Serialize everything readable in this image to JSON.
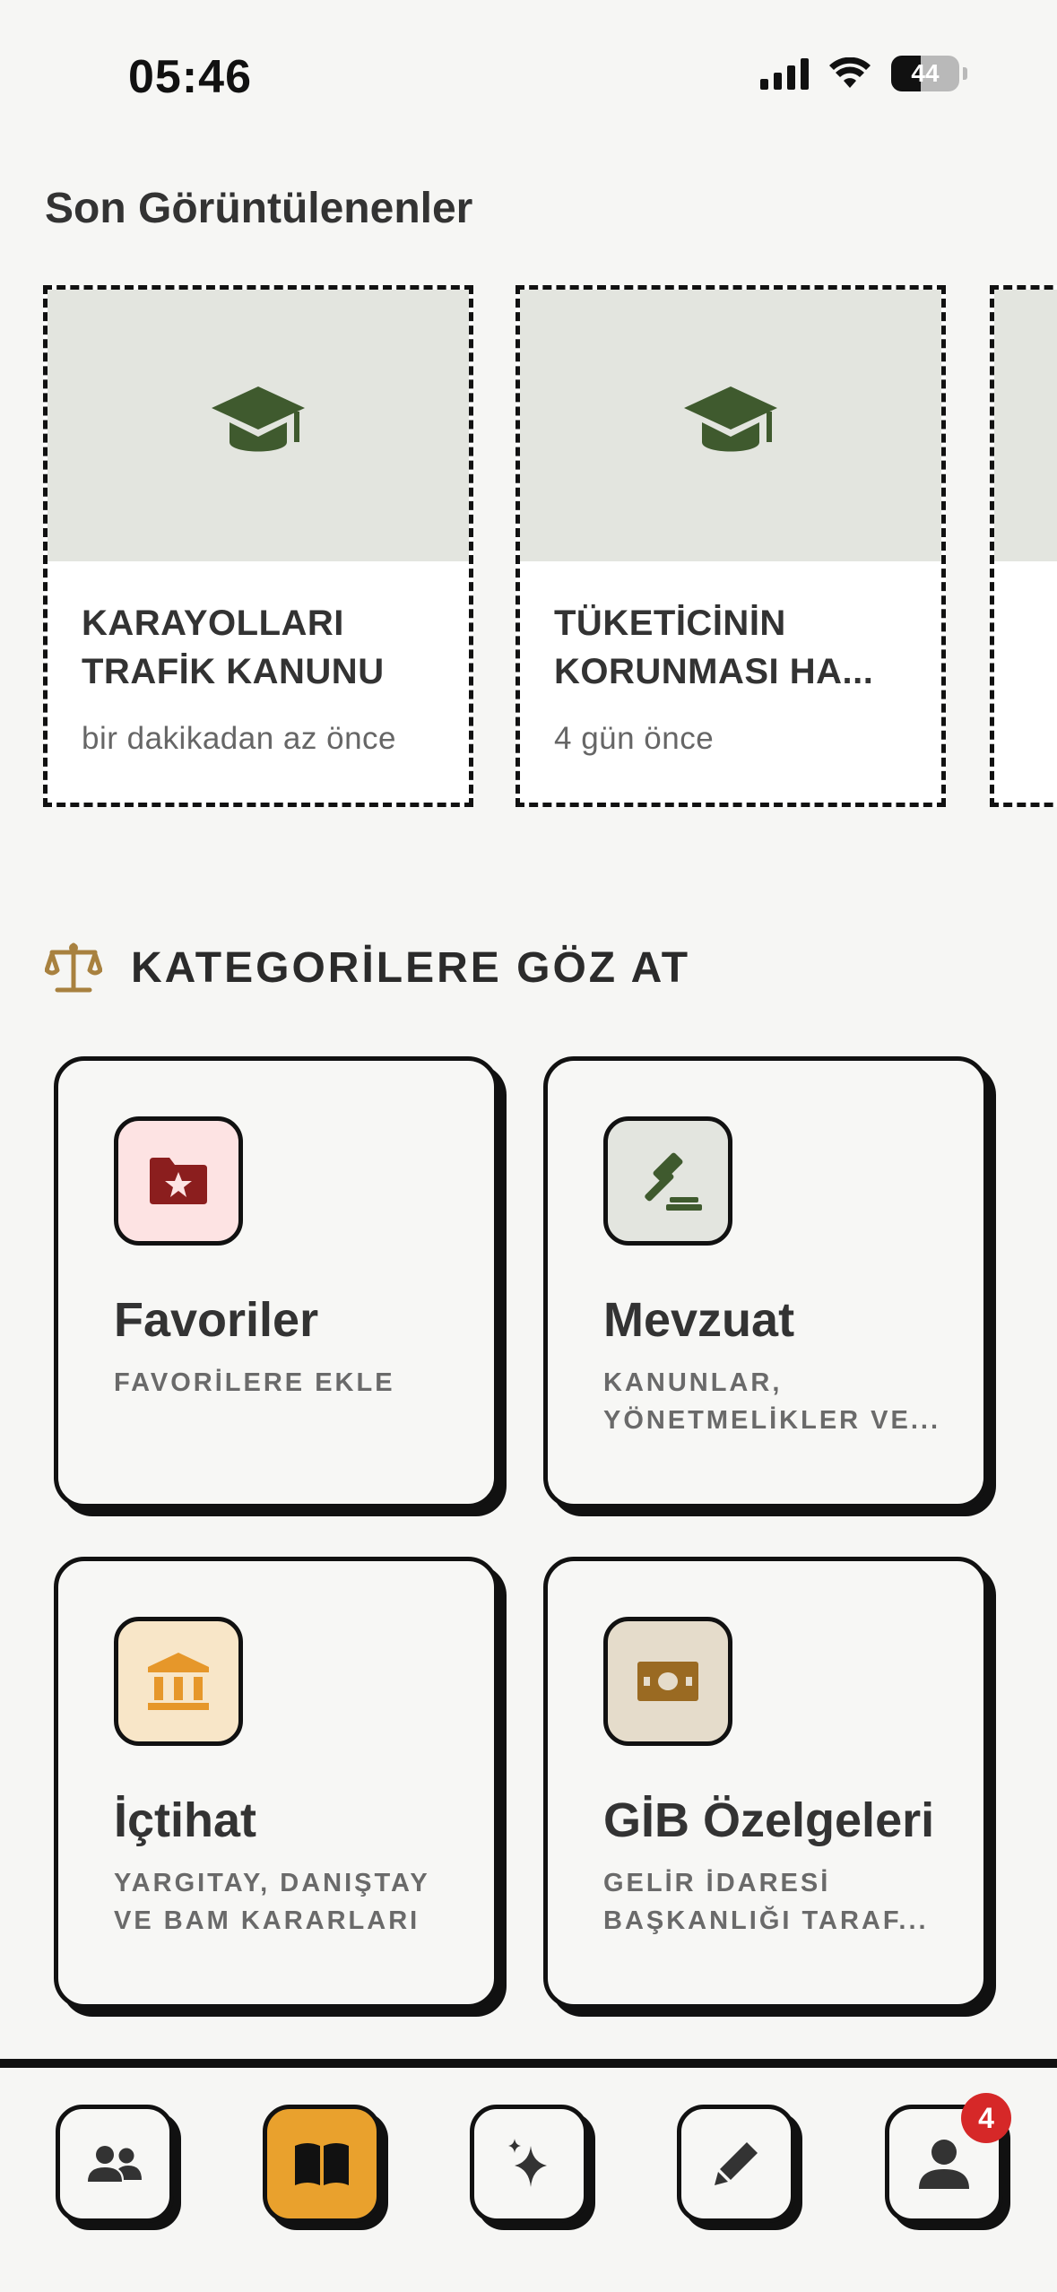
{
  "status_bar": {
    "time": "05:46",
    "battery": "44",
    "battery_level": 0.44
  },
  "recent": {
    "title": "Son Görüntülenenler",
    "items": [
      {
        "title": "KARAYOLLARI TRAFİK KANUNU",
        "time": "bir dakikadan az önce",
        "icon": "graduation-cap-icon"
      },
      {
        "title": "TÜKETİCİNİN KORUNMASI HA...",
        "time": "4 gün önce",
        "icon": "graduation-cap-icon"
      }
    ]
  },
  "categories": {
    "title": "KATEGORİLERE GÖZ AT",
    "icon": "scales-icon",
    "items": [
      {
        "name": "Favoriler",
        "desc": "FAVORİLERE EKLE",
        "icon": "folder-star-icon",
        "bg": "#fde3e3",
        "color": "#8b1e1e"
      },
      {
        "name": "Mevzuat",
        "desc": "KANUNLAR, YÖNETMELİKLER VE...",
        "icon": "gavel-icon",
        "bg": "#e3e5df",
        "color": "#3f5a2e"
      },
      {
        "name": "İçtihat",
        "desc": "YARGITAY, DANIŞTAY VE BAM KARARLARI",
        "icon": "bank-icon",
        "bg": "#f8e6c8",
        "color": "#e6972a"
      },
      {
        "name": "GİB Özelgeleri",
        "desc": "GELİR İDARESİ BAŞKANLIĞI TARAF...",
        "icon": "money-icon",
        "bg": "#e5dccb",
        "color": "#9a6a22"
      }
    ]
  },
  "nav": {
    "items": [
      {
        "icon": "users-icon",
        "active": false
      },
      {
        "icon": "book-icon",
        "active": true
      },
      {
        "icon": "sparkles-icon",
        "active": false
      },
      {
        "icon": "pen-icon",
        "active": false
      },
      {
        "icon": "profile-icon",
        "active": false,
        "badge": "4"
      }
    ]
  },
  "colors": {
    "accent": "#e9a12d",
    "badge": "#d62828",
    "dark_green": "#3f5a2e",
    "gold": "#a8813f"
  }
}
